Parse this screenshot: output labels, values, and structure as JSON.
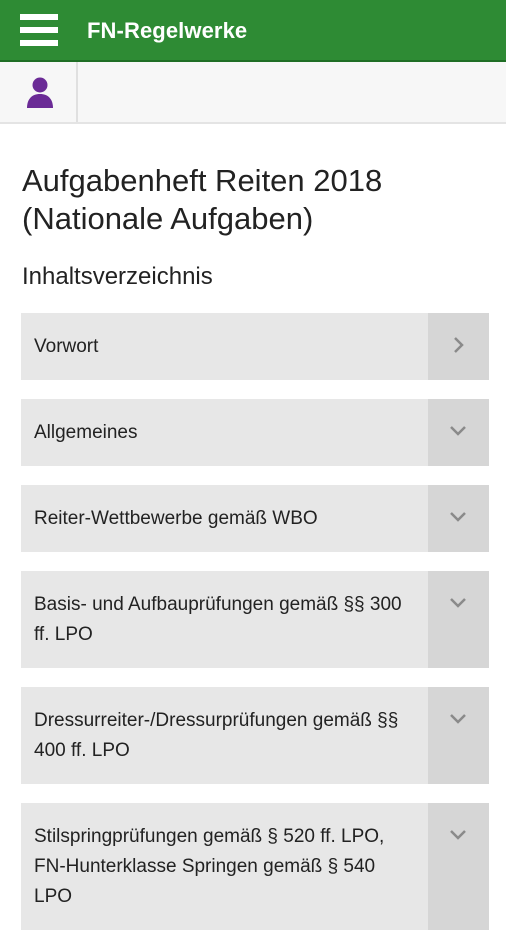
{
  "appbar": {
    "title": "FN-Regelwerke",
    "menu_icon": "hamburger-menu-icon",
    "color": "#2e8b34"
  },
  "toolbar": {
    "user_icon": "user-icon",
    "user_icon_color": "#6b2b96"
  },
  "page": {
    "title": "Aufgabenheft Reiten 2018 (Nationale Aufgaben)",
    "section_title": "Inhaltsverzeichnis"
  },
  "toc": {
    "items": [
      {
        "label": "Vorwort",
        "icon": "chevron-right-icon"
      },
      {
        "label": "Allgemeines",
        "icon": "chevron-down-icon"
      },
      {
        "label": "Reiter-Wettbewerbe gemäß WBO",
        "icon": "chevron-down-icon"
      },
      {
        "label": "Basis- und Aufbauprüfungen gemäß §§ 300 ff. LPO",
        "icon": "chevron-down-icon"
      },
      {
        "label": "Dressurreiter-/Dressurprüfungen gemäß §§ 400 ff. LPO",
        "icon": "chevron-down-icon"
      },
      {
        "label": "Stilspringprüfungen gemäß § 520 ff. LPO, FN-Hunterklasse Springen gemäß § 540 LPO",
        "icon": "chevron-down-icon"
      }
    ]
  }
}
